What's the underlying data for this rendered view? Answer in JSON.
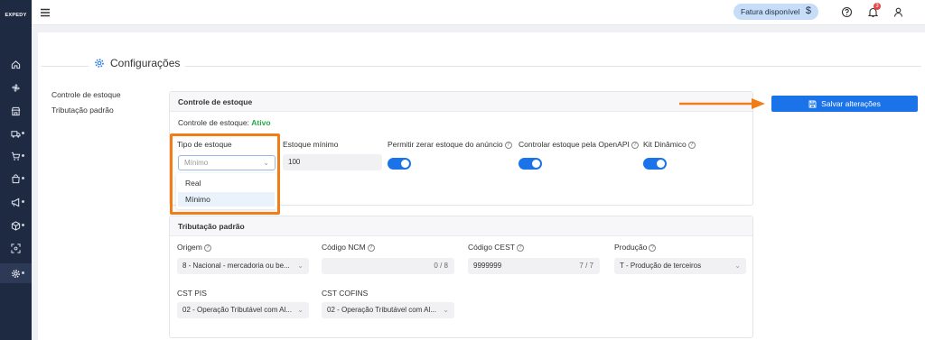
{
  "app": {
    "logo": "EXPEDY"
  },
  "topbar": {
    "invoice_label": "Fatura disponível",
    "invoice_icon": "$",
    "notification_count": "3"
  },
  "page": {
    "title": "Configurações"
  },
  "subnav": {
    "items": [
      "Controle de estoque",
      "Tributação padrão"
    ]
  },
  "actions": {
    "save_label": "Salvar alterações"
  },
  "stock": {
    "section_title": "Controle de estoque",
    "status_label": "Controle de estoque:",
    "status_value": "Ativo",
    "type_label": "Tipo de estoque",
    "type_placeholder": "Mínimo",
    "type_options": [
      "Real",
      "Mínimo"
    ],
    "min_label": "Estoque mínimo",
    "min_value": "100",
    "toggles": [
      {
        "label": "Permitir zerar estoque do anúncio",
        "on": true
      },
      {
        "label": "Controlar estoque pela OpenAPI",
        "on": true
      },
      {
        "label": "Kit Dinâmico",
        "on": true
      }
    ]
  },
  "tax": {
    "section_title": "Tributação padrão",
    "origem_label": "Origem",
    "origem_value": "8 - Nacional - mercadoria ou be...",
    "ncm_label": "Código NCM",
    "ncm_value": "",
    "ncm_count": "0 / 8",
    "cest_label": "Código CEST",
    "cest_value": "9999999",
    "cest_count": "7 / 7",
    "producao_label": "Produção",
    "producao_value": "T - Produção de terceiros",
    "pis_label": "CST PIS",
    "pis_value": "02 - Operação Tributável com Al...",
    "cofins_label": "CST COFINS",
    "cofins_value": "02 - Operação Tributável com Al..."
  },
  "colors": {
    "primary": "#1a73e8",
    "sidebar": "#1e2a42",
    "highlight": "#f07d18",
    "success": "#28a745"
  }
}
